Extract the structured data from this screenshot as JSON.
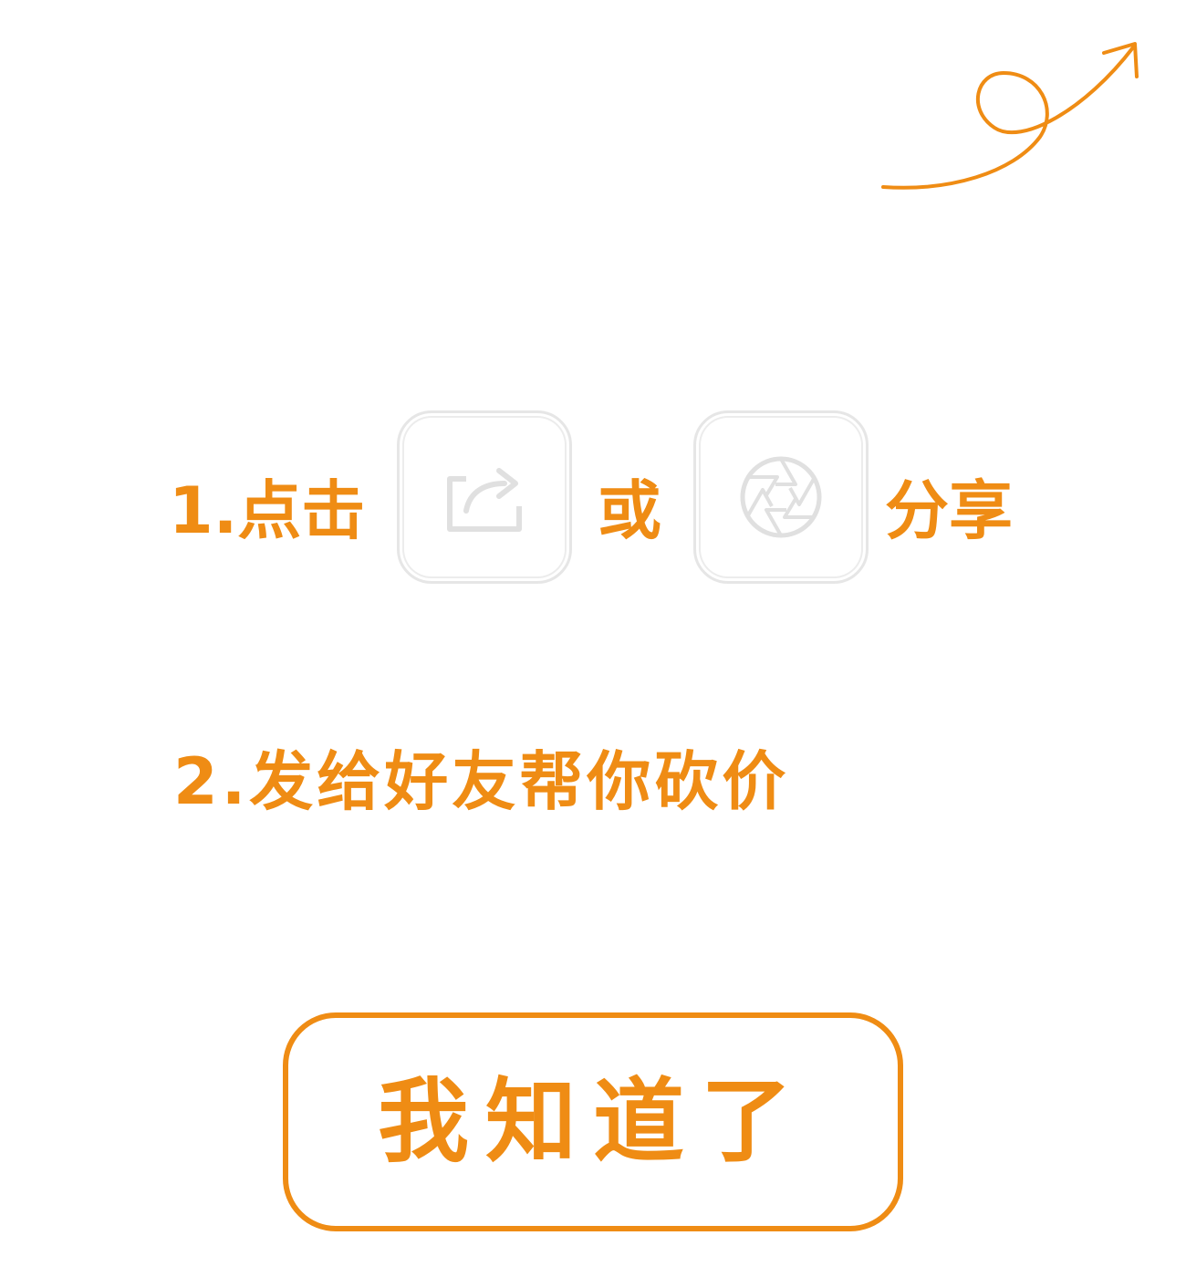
{
  "step1": {
    "prefix": "1.点击",
    "or": "或",
    "suffix": "分享"
  },
  "step2": {
    "text": "2.发给好友帮你砍价"
  },
  "button": {
    "label": "我知道了"
  },
  "icons": {
    "hint_arrow": "curly-arrow-icon",
    "share": "share-icon",
    "moments": "aperture-icon"
  },
  "colors": {
    "accent": "#ef8c14",
    "icon_outline": "#e6e6e6"
  }
}
